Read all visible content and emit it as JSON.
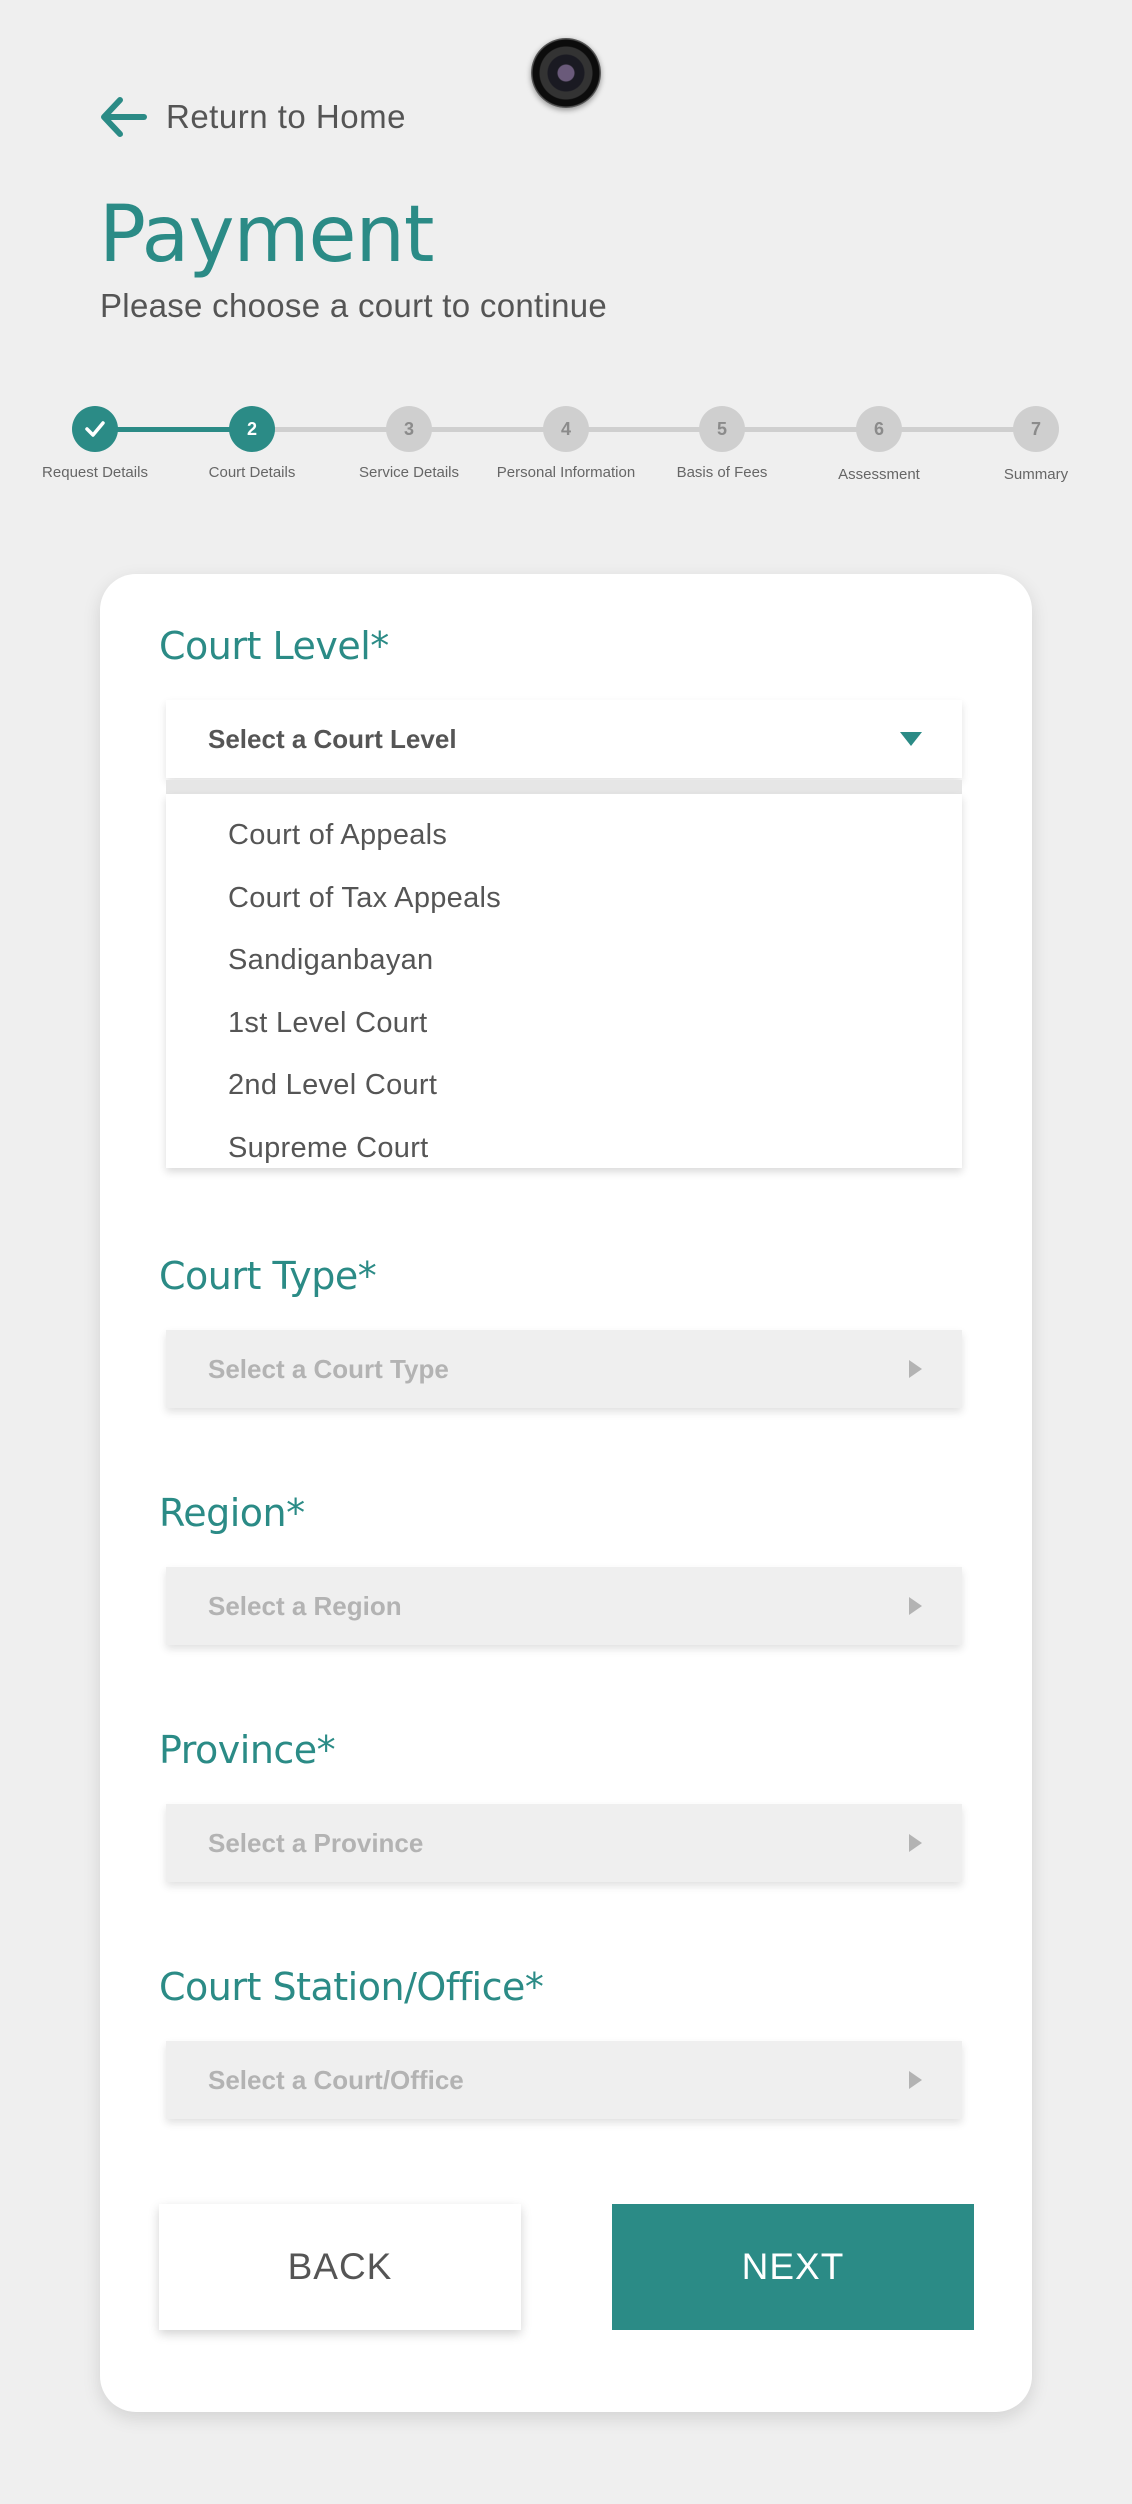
{
  "header": {
    "return_label": "Return to Home",
    "title": "Payment",
    "subtitle": "Please choose a court to continue"
  },
  "stepper": {
    "current_step": 2,
    "steps": [
      {
        "number": "",
        "label": "Request Details",
        "status": "done"
      },
      {
        "number": "2",
        "label": "Court Details",
        "status": "active"
      },
      {
        "number": "3",
        "label": "Service Details",
        "status": "pending"
      },
      {
        "number": "4",
        "label": "Personal Information",
        "status": "pending"
      },
      {
        "number": "5",
        "label": "Basis of Fees",
        "status": "pending"
      },
      {
        "number": "6",
        "label": "Assessment",
        "status": "pending"
      },
      {
        "number": "7",
        "label": "Summary",
        "status": "pending"
      }
    ]
  },
  "form": {
    "court_level": {
      "label": "Court Level*",
      "placeholder": "Select a Court Level",
      "options": [
        "Court of Appeals",
        "Court of Tax Appeals",
        "Sandiganbayan",
        "1st Level Court",
        "2nd Level Court",
        "Supreme Court"
      ]
    },
    "court_type": {
      "label": "Court Type*",
      "placeholder": "Select a Court Type"
    },
    "region": {
      "label": "Region*",
      "placeholder": "Select a Region"
    },
    "province": {
      "label": "Province*",
      "placeholder": "Select a Province"
    },
    "court_station": {
      "label": "Court Station/Office*",
      "placeholder": "Select a Court/Office"
    }
  },
  "actions": {
    "back_label": "BACK",
    "next_label": "NEXT"
  },
  "colors": {
    "accent": "#2b8b86",
    "inactive": "#cfcfcf",
    "background": "#efefef"
  }
}
